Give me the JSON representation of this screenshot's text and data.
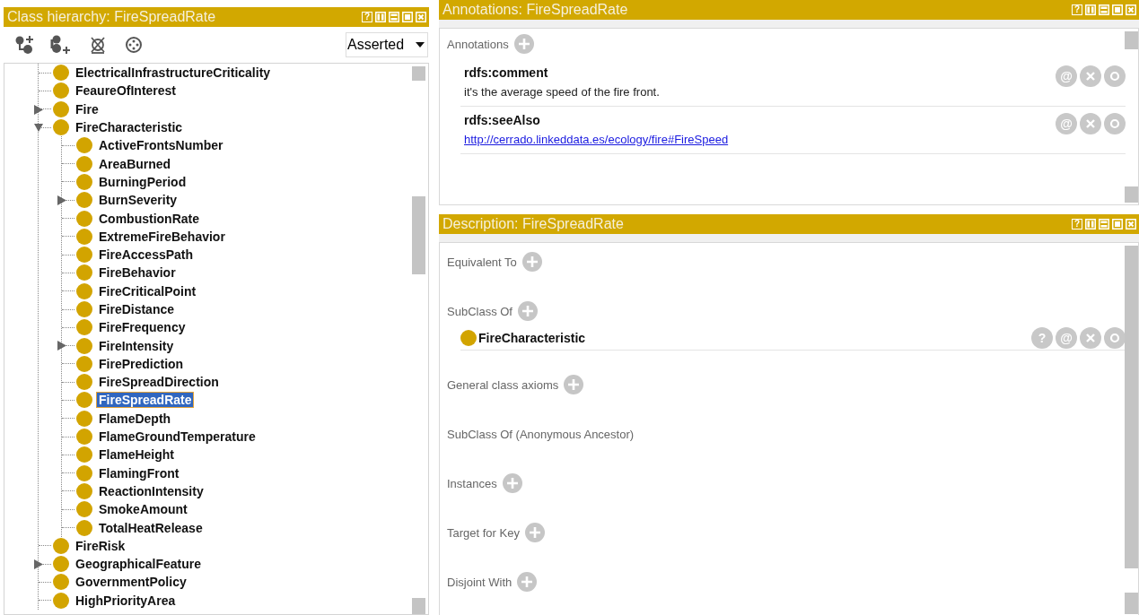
{
  "class_hierarchy": {
    "title": "Class hierarchy: FireSpreadRate",
    "header_controls": [
      {
        "kind": "help",
        "label": "?"
      },
      {
        "kind": "split-v"
      },
      {
        "kind": "split-h"
      },
      {
        "kind": "maximize"
      },
      {
        "kind": "close"
      }
    ],
    "toolbar": [
      {
        "kind": "add-subclass"
      },
      {
        "kind": "add-sibling"
      },
      {
        "kind": "delete"
      },
      {
        "kind": "target"
      }
    ],
    "view_select": {
      "value": "Asserted"
    },
    "tree": [
      {
        "label": "ElectricalInfrastructureCriticality",
        "selected": false
      },
      {
        "label": "FeaureOfInterest",
        "selected": false
      },
      {
        "label": "Fire",
        "selected": false,
        "expanded": false
      },
      {
        "label": "FireCharacteristic",
        "selected": false,
        "expanded": true,
        "children": [
          {
            "label": "ActiveFrontsNumber",
            "selected": false
          },
          {
            "label": "AreaBurned",
            "selected": false
          },
          {
            "label": "BurningPeriod",
            "selected": false
          },
          {
            "label": "BurnSeverity",
            "selected": false,
            "expanded": false
          },
          {
            "label": "CombustionRate",
            "selected": false
          },
          {
            "label": "ExtremeFireBehavior",
            "selected": false
          },
          {
            "label": "FireAccessPath",
            "selected": false
          },
          {
            "label": "FireBehavior",
            "selected": false
          },
          {
            "label": "FireCriticalPoint",
            "selected": false
          },
          {
            "label": "FireDistance",
            "selected": false
          },
          {
            "label": "FireFrequency",
            "selected": false
          },
          {
            "label": "FireIntensity",
            "selected": false,
            "expanded": false
          },
          {
            "label": "FirePrediction",
            "selected": false
          },
          {
            "label": "FireSpreadDirection",
            "selected": false
          },
          {
            "label": "FireSpreadRate",
            "selected": true
          },
          {
            "label": "FlameDepth",
            "selected": false
          },
          {
            "label": "FlameGroundTemperature",
            "selected": false
          },
          {
            "label": "FlameHeight",
            "selected": false
          },
          {
            "label": "FlamingFront",
            "selected": false
          },
          {
            "label": "ReactionIntensity",
            "selected": false
          },
          {
            "label": "SmokeAmount",
            "selected": false
          },
          {
            "label": "TotalHeatRelease",
            "selected": false
          }
        ]
      },
      {
        "label": "FireRisk",
        "selected": false
      },
      {
        "label": "GeographicalFeature",
        "selected": false,
        "expanded": false
      },
      {
        "label": "GovernmentPolicy",
        "selected": false
      },
      {
        "label": "HighPriorityArea",
        "selected": false
      }
    ]
  },
  "annotations": {
    "title": "Annotations: FireSpreadRate",
    "header_controls": [
      {
        "kind": "help",
        "label": "?"
      },
      {
        "kind": "split-v"
      },
      {
        "kind": "split-h"
      },
      {
        "kind": "maximize"
      },
      {
        "kind": "close"
      }
    ],
    "section_label": "Annotations",
    "items": [
      {
        "property": "rdfs:comment",
        "value": "it's the average speed of the fire front.",
        "kind": "text",
        "actions": [
          {
            "kind": "annotate",
            "label": "@"
          },
          {
            "kind": "delete"
          },
          {
            "kind": "edit"
          }
        ]
      },
      {
        "property": "rdfs:seeAlso",
        "value": "http://cerrado.linkeddata.es/ecology/fire#FireSpeed",
        "kind": "link",
        "actions": [
          {
            "kind": "annotate",
            "label": "@"
          },
          {
            "kind": "delete"
          },
          {
            "kind": "edit"
          }
        ]
      }
    ]
  },
  "description": {
    "title": "Description: FireSpreadRate",
    "header_controls": [
      {
        "kind": "help",
        "label": "?"
      },
      {
        "kind": "split-v"
      },
      {
        "kind": "split-h"
      },
      {
        "kind": "maximize"
      },
      {
        "kind": "close"
      }
    ],
    "sections": [
      {
        "label": "Equivalent To",
        "addable": true
      },
      {
        "label": "SubClass Of",
        "addable": true,
        "items": [
          {
            "label": "FireCharacteristic",
            "actions": [
              {
                "kind": "explain",
                "label": "?"
              },
              {
                "kind": "annotate",
                "label": "@"
              },
              {
                "kind": "delete"
              },
              {
                "kind": "edit"
              }
            ]
          }
        ]
      },
      {
        "label": "General class axioms",
        "addable": true
      },
      {
        "label": "SubClass Of (Anonymous Ancestor)",
        "addable": false
      },
      {
        "label": "Instances",
        "addable": true
      },
      {
        "label": "Target for Key",
        "addable": true
      },
      {
        "label": "Disjoint With",
        "addable": true
      }
    ]
  }
}
